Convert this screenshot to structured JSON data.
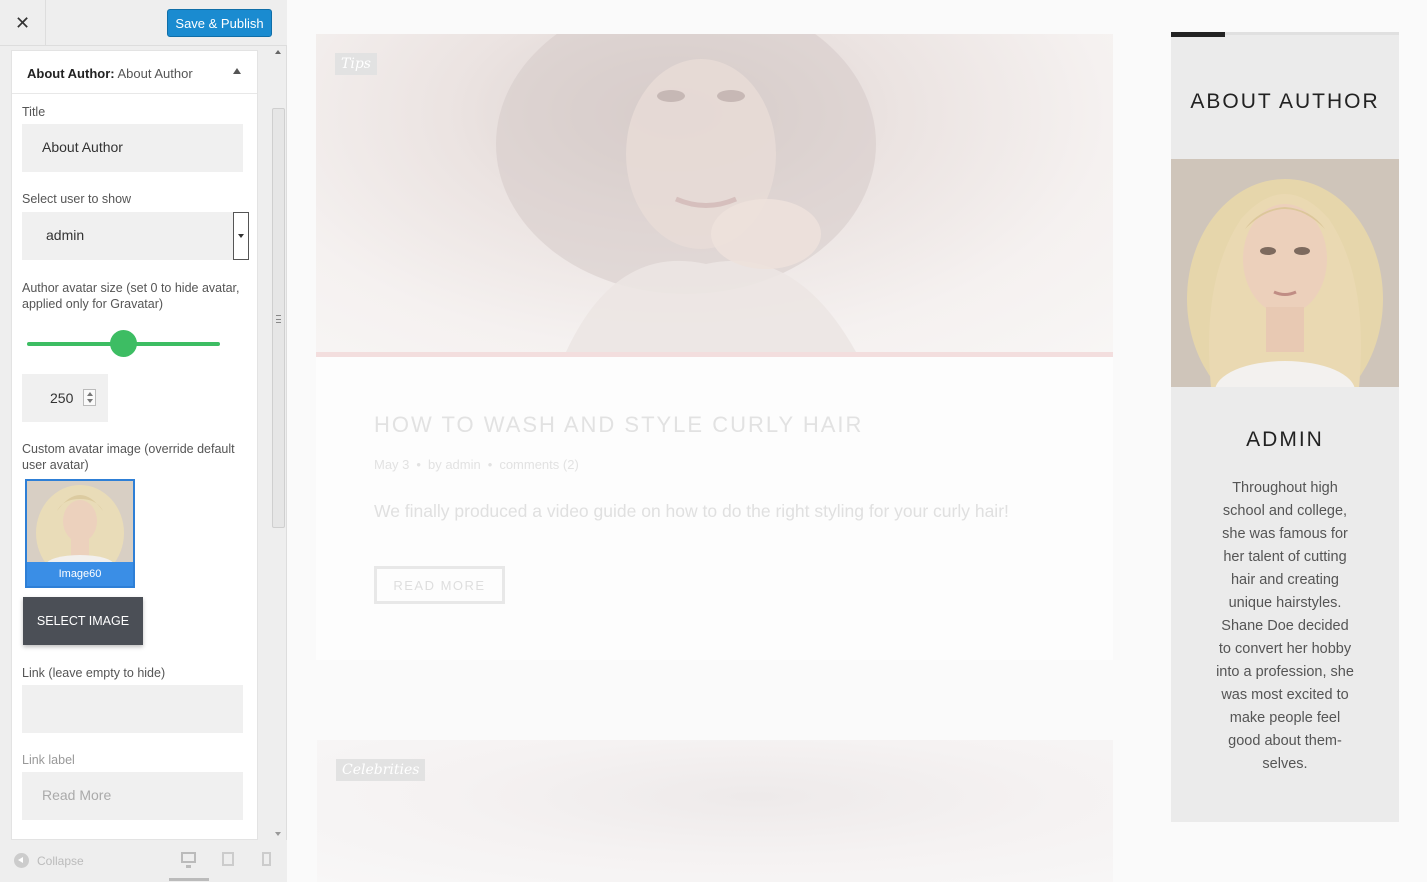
{
  "topbar": {
    "close_glyph": "✕",
    "publish_label": "Save & Publish"
  },
  "panel": {
    "header_bold": "About Author:",
    "header_title": "About Author",
    "title_label": "Title",
    "title_value": "About Author",
    "user_label": "Select user to show",
    "user_value": "admin",
    "avatar_size_label": "Author avatar size (set 0 to hide avatar, applied only for Gravatar)",
    "avatar_size_value": "250",
    "avatar_size_slider_fraction": 0.5,
    "custom_avatar_label": "Custom avatar image (override default user avatar)",
    "avatar_caption": "Image60",
    "select_image_label": "SELECT IMAGE",
    "link_label": "Link (leave empty to hide)",
    "link_value": "",
    "link_label_label": "Link label",
    "link_label_placeholder": "Read More"
  },
  "footer": {
    "collapse_label": "Collapse"
  },
  "preview": {
    "post1": {
      "tag": "Tips",
      "title": "HOW TO WASH AND STYLE CURLY HAIR",
      "date": "May 3",
      "by": "by",
      "author": "admin",
      "comments": "comments (2)",
      "excerpt": "We finally produced a video guide on how to do the right styling for your curly hair!",
      "read_more": "READ MORE"
    },
    "post2": {
      "tag": "Celebrities"
    }
  },
  "widget": {
    "title": "ABOUT AUTHOR",
    "name": "ADMIN",
    "bio": "Throughout high school and college, she was famous for her talent of cutting hair and creating unique hairstyles. Shane Doe decided to convert her hobby into a profession, she was most excited to make people feel good about them-selves."
  },
  "colors": {
    "publish_blue": "#1a8bd0",
    "slider_green": "#3dbd63",
    "avatar_selected_blue": "#3a8ee6",
    "select_button_dark": "#4b4f56"
  }
}
